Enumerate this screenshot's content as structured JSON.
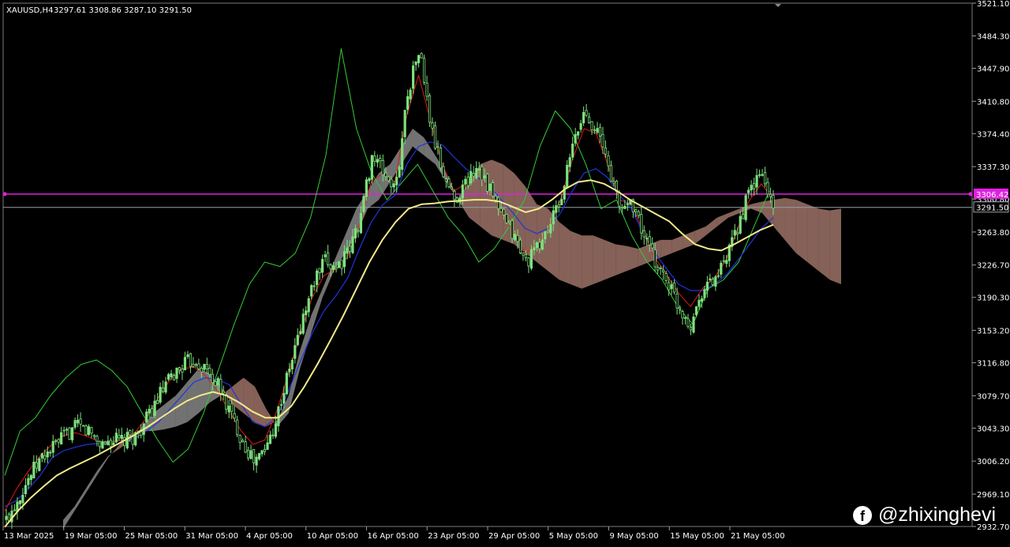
{
  "chart_data": {
    "type": "candlestick",
    "symbol_info": {
      "label": "XAUUSD,H4",
      "ohlc": "3297.61 3308.86 3287.10 3291.50"
    },
    "x_ticks": [
      "13 Mar 2025",
      "19 Mar 05:00",
      "25 Mar 05:00",
      "31 Mar 05:00",
      "4 Apr 05:00",
      "10 Apr 05:00",
      "16 Apr 05:00",
      "23 Apr 05:00",
      "29 Apr 05:00",
      "5 May 05:00",
      "9 May 05:00",
      "15 May 05:00",
      "21 May 05:00"
    ],
    "y_ticks": [
      "3521.10",
      "3484.30",
      "3447.90",
      "3410.80",
      "3374.40",
      "3337.30",
      "3300.80",
      "3263.80",
      "3226.70",
      "3190.30",
      "3153.20",
      "3116.80",
      "3079.70",
      "3043.30",
      "3006.20",
      "2969.10",
      "2932.70"
    ],
    "ylim": [
      2932.7,
      3521.1
    ],
    "horizontal_lines": [
      {
        "label": "3306.42",
        "price": 3306.42,
        "color": "#e020e0"
      },
      {
        "label": "3291.50",
        "price": 3291.5,
        "color": "#9aa0a8"
      }
    ],
    "series": [
      {
        "key": "price",
        "values": [
          2940,
          2965,
          2990,
          3010,
          3022,
          3035,
          3045,
          3040,
          3025,
          3030,
          3028,
          3035,
          3055,
          3080,
          3100,
          3115,
          3120,
          3108,
          3090,
          3060,
          3030,
          3005,
          3020,
          3060,
          3110,
          3160,
          3205,
          3230,
          3225,
          3240,
          3280,
          3350,
          3330,
          3310,
          3420,
          3470,
          3380,
          3330,
          3300,
          3320,
          3340,
          3310,
          3280,
          3260,
          3230,
          3245,
          3270,
          3300,
          3360,
          3400,
          3380,
          3340,
          3290,
          3300,
          3260,
          3230,
          3210,
          3180,
          3160,
          3200,
          3210,
          3230,
          3270,
          3310,
          3330,
          3292
        ]
      },
      {
        "key": "chikou",
        "values": [
          2990,
          3040,
          3055,
          3080,
          3100,
          3115,
          3120,
          3108,
          3090,
          3060,
          3030,
          3005,
          3020,
          3060,
          3110,
          3160,
          3205,
          3230,
          3225,
          3240,
          3280,
          3350,
          3470,
          3380,
          3330,
          3300,
          3320,
          3340,
          3310,
          3280,
          3260,
          3230,
          3245,
          3270,
          3300,
          3360,
          3400,
          3380,
          3340,
          3290,
          3300,
          3260,
          3230,
          3210,
          3180,
          3160,
          3200,
          3210,
          3230,
          3270,
          3310
        ]
      },
      {
        "key": "tenkan",
        "values": [
          2950,
          2975,
          2995,
          3012,
          3025,
          3035,
          3038,
          3034,
          3028,
          3028,
          3030,
          3038,
          3055,
          3078,
          3098,
          3110,
          3112,
          3102,
          3085,
          3062,
          3040,
          3025,
          3030,
          3062,
          3105,
          3150,
          3190,
          3215,
          3222,
          3236,
          3272,
          3320,
          3330,
          3320,
          3395,
          3440,
          3390,
          3340,
          3310,
          3318,
          3330,
          3310,
          3285,
          3265,
          3240,
          3248,
          3268,
          3300,
          3345,
          3380,
          3375,
          3340,
          3300,
          3295,
          3265,
          3235,
          3215,
          3195,
          3180,
          3200,
          3212,
          3232,
          3268,
          3300,
          3318,
          3300
        ]
      },
      {
        "key": "kijun",
        "values": [
          2955,
          2962,
          2975,
          2990,
          3010,
          3018,
          3022,
          3025,
          3026,
          3028,
          3030,
          3032,
          3040,
          3050,
          3065,
          3080,
          3095,
          3100,
          3098,
          3092,
          3070,
          3050,
          3045,
          3055,
          3085,
          3118,
          3150,
          3175,
          3192,
          3212,
          3245,
          3275,
          3295,
          3305,
          3340,
          3360,
          3365,
          3362,
          3348,
          3335,
          3325,
          3315,
          3300,
          3285,
          3268,
          3262,
          3268,
          3285,
          3310,
          3330,
          3335,
          3325,
          3305,
          3290,
          3262,
          3240,
          3222,
          3205,
          3198,
          3198,
          3205,
          3215,
          3232,
          3250,
          3268,
          3280
        ]
      },
      {
        "key": "ma",
        "values": [
          2932,
          2950,
          2965,
          2978,
          2990,
          2998,
          3005,
          3012,
          3020,
          3028,
          3036,
          3045,
          3055,
          3065,
          3074,
          3080,
          3084,
          3080,
          3072,
          3062,
          3055,
          3055,
          3068,
          3090,
          3115,
          3142,
          3170,
          3200,
          3230,
          3255,
          3275,
          3290,
          3295,
          3296,
          3298,
          3299,
          3300,
          3300,
          3298,
          3292,
          3286,
          3290,
          3300,
          3312,
          3320,
          3322,
          3318,
          3310,
          3300,
          3292,
          3284,
          3276,
          3262,
          3250,
          3245,
          3243,
          3250,
          3258,
          3266,
          3272
        ]
      },
      {
        "key": "span_a",
        "values": [
          2930,
          2950,
          2970,
          2990,
          3010,
          3025,
          3035,
          3040,
          3040,
          3042,
          3045,
          3050,
          3060,
          3072,
          3080,
          3090,
          3100,
          3090,
          3065,
          3045,
          3060,
          3110,
          3150,
          3190,
          3220,
          3240,
          3260,
          3290,
          3300,
          3320,
          3340,
          3360,
          3350,
          3340,
          3320,
          3300,
          3320,
          3340,
          3345,
          3340,
          3330,
          3315,
          3295,
          3290,
          3275,
          3265,
          3260,
          3260,
          3255,
          3250,
          3248,
          3245,
          3250,
          3255,
          3255,
          3260,
          3265,
          3270,
          3280,
          3285,
          3290,
          3295,
          3298,
          3300,
          3302,
          3300,
          3295,
          3290,
          3288,
          3290
        ]
      },
      {
        "key": "span_b",
        "values": [
          2940,
          2955,
          2975,
          2995,
          3012,
          3020,
          3030,
          3045,
          3060,
          3070,
          3080,
          3095,
          3110,
          3105,
          3090,
          3070,
          3060,
          3050,
          3045,
          3052,
          3080,
          3130,
          3170,
          3200,
          3230,
          3260,
          3290,
          3310,
          3330,
          3340,
          3360,
          3380,
          3370,
          3350,
          3330,
          3300,
          3280,
          3270,
          3260,
          3255,
          3250,
          3240,
          3230,
          3220,
          3210,
          3205,
          3200,
          3205,
          3210,
          3215,
          3220,
          3225,
          3230,
          3235,
          3240,
          3245,
          3250,
          3260,
          3270,
          3280,
          3285,
          3290,
          3285,
          3270,
          3255,
          3240,
          3230,
          3220,
          3210,
          3205
        ]
      }
    ]
  },
  "watermark": {
    "icon": "facebook-icon",
    "text": "@zhixinghevi"
  },
  "colors": {
    "background": "#000000",
    "candles": "#7ee07e",
    "chikou": "#33cc33",
    "tenkan": "#e01818",
    "kijun": "#2233dd",
    "ma": "#f2ea8a",
    "cloud_bull": "#f2b0a0",
    "cloud_bear": "#cfcfcf"
  }
}
